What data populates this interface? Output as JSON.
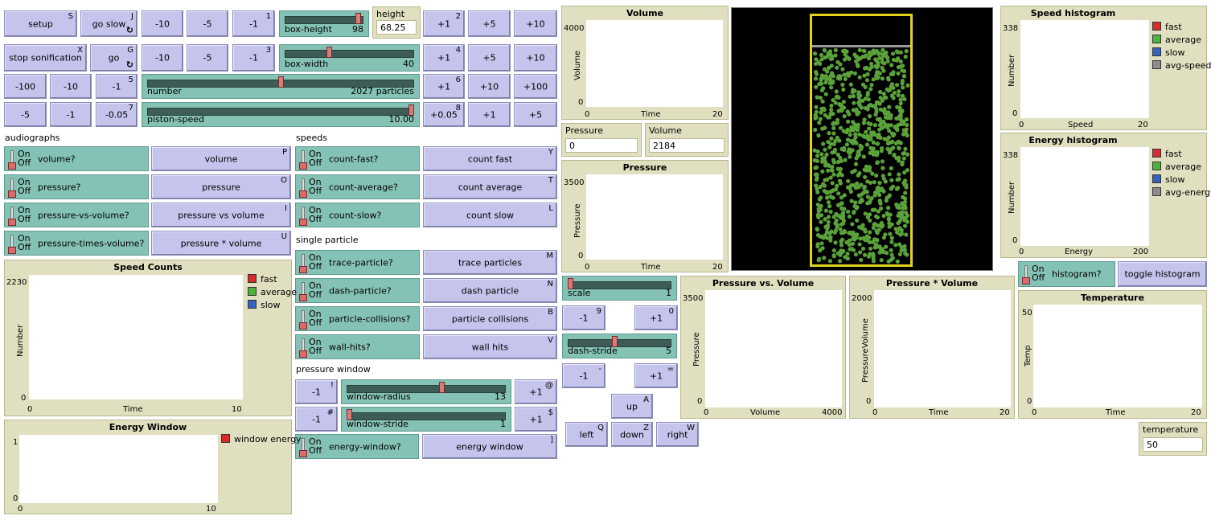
{
  "buttons": {
    "setup": {
      "label": "setup",
      "key": "S"
    },
    "go_slow": {
      "label": "go slow",
      "key": "J"
    },
    "stop_sonification": {
      "label": "stop sonification",
      "key": "X"
    },
    "go": {
      "label": "go",
      "key": "G"
    },
    "row1_dec": [
      "-10",
      "-5",
      "-1"
    ],
    "row1_key": "1",
    "row1_inc": [
      "+1",
      "+5",
      "+10"
    ],
    "row1_inc_key": "2",
    "row2_dec": [
      "-10",
      "-5",
      "-1"
    ],
    "row2_key": "3",
    "row2_inc": [
      "+1",
      "+5",
      "+10"
    ],
    "row2_inc_key": "4",
    "row3_dec": [
      "-100",
      "-10",
      "-1"
    ],
    "row3_key": "5",
    "row3_inc": [
      "+1",
      "+10",
      "+100"
    ],
    "row3_inc_key": "6",
    "row4_dec": [
      "-5",
      "-1",
      "-0.05"
    ],
    "row4_key": "7",
    "row4_inc": [
      "+0.05",
      "+1",
      "+5"
    ],
    "row4_inc_key": "8",
    "audio": [
      {
        "label": "volume",
        "key": "P"
      },
      {
        "label": "pressure",
        "key": "O"
      },
      {
        "label": "pressure vs volume",
        "key": "I"
      },
      {
        "label": "pressure * volume",
        "key": "U"
      }
    ],
    "speeds": [
      {
        "label": "count fast",
        "key": "Y"
      },
      {
        "label": "count average",
        "key": "T"
      },
      {
        "label": "count slow",
        "key": "L"
      }
    ],
    "single": [
      {
        "label": "trace particles",
        "key": "M"
      },
      {
        "label": "dash particle",
        "key": "N"
      },
      {
        "label": "particle collisions",
        "key": "B"
      },
      {
        "label": "wall hits",
        "key": "V"
      }
    ],
    "win_radius_dec": {
      "label": "-1",
      "key": "!"
    },
    "win_radius_inc": {
      "label": "+1",
      "key": "@"
    },
    "win_stride_dec": {
      "label": "-1",
      "key": "#"
    },
    "win_stride_inc": {
      "label": "+1",
      "key": "$"
    },
    "energy_window": {
      "label": "energy window",
      "key": "]"
    },
    "scale_dec": {
      "label": "-1",
      "key": "9"
    },
    "scale_inc": {
      "label": "+1",
      "key": "0"
    },
    "stride_dec": {
      "label": "-1",
      "key": "-"
    },
    "stride_inc": {
      "label": "+1",
      "key": "="
    },
    "up": {
      "label": "up",
      "key": "A"
    },
    "left": {
      "label": "left",
      "key": "Q"
    },
    "down": {
      "label": "down",
      "key": "Z"
    },
    "right": {
      "label": "right",
      "key": "W"
    },
    "toggle_histogram": {
      "label": "toggle histogram"
    }
  },
  "sliders": {
    "box_height": {
      "name": "box-height",
      "value": "98",
      "fraction": 0.97
    },
    "box_width": {
      "name": "box-width",
      "value": "40",
      "fraction": 0.34
    },
    "number": {
      "name": "number",
      "value": "2027 particles",
      "fraction": 0.5
    },
    "piston_speed": {
      "name": "piston-speed",
      "value": "10.00",
      "fraction": 1.0
    },
    "window_radius": {
      "name": "window-radius",
      "value": "13",
      "fraction": 0.6
    },
    "window_stride": {
      "name": "window-stride",
      "value": "1",
      "fraction": 0.0
    },
    "scale": {
      "name": "scale",
      "value": "1",
      "fraction": 0.0
    },
    "dash_stride": {
      "name": "dash-stride",
      "value": "5",
      "fraction": 0.45
    }
  },
  "switch_text": {
    "on": "On",
    "off": "Off"
  },
  "switches": {
    "volume": "volume?",
    "pressure": "pressure?",
    "pressure_vs_volume": "pressure-vs-volume?",
    "pressure_times_volume": "pressure-times-volume?",
    "count_fast": "count-fast?",
    "count_average": "count-average?",
    "count_slow": "count-slow?",
    "trace_particle": "trace-particle?",
    "dash_particle": "dash-particle?",
    "particle_collisions": "particle-collisions?",
    "wall_hits": "wall-hits?",
    "energy_window": "energy-window?",
    "histogram": "histogram?"
  },
  "notes": {
    "audiographs": "audiographs",
    "speeds": "speeds",
    "single_particle": "single particle",
    "pressure_window": "pressure window"
  },
  "monitors": {
    "height": {
      "label": "height",
      "value": "68.25"
    },
    "pressure": {
      "label": "Pressure",
      "value": "0"
    },
    "volume": {
      "label": "Volume",
      "value": "2184"
    },
    "temperature": {
      "label": "temperature",
      "value": "50"
    }
  },
  "plots": {
    "volume": {
      "title": "Volume",
      "ylabel": "Volume",
      "xlabel": "Time",
      "ymax": "4000",
      "ymin": "0",
      "xmin": "0",
      "xmax": "20"
    },
    "pressure": {
      "title": "Pressure",
      "ylabel": "Pressure",
      "xlabel": "Time",
      "ymax": "3500",
      "ymin": "0",
      "xmin": "0",
      "xmax": "20"
    },
    "speed_counts": {
      "title": "Speed Counts",
      "ylabel": "Number",
      "xlabel": "Time",
      "ymax": "2230",
      "ymin": "0",
      "xmin": "0",
      "xmax": "10",
      "legend": [
        {
          "name": "fast",
          "color": "#d92b2b"
        },
        {
          "name": "average",
          "color": "#4bb33b"
        },
        {
          "name": "slow",
          "color": "#3463bf"
        }
      ]
    },
    "energy_window": {
      "title": "Energy Window",
      "ymax": "1",
      "ymin": "0",
      "xmin": "0",
      "xmax": "10",
      "legend": [
        {
          "name": "window energy",
          "color": "#d92b2b"
        }
      ]
    },
    "pv": {
      "title": "Pressure vs. Volume",
      "ylabel": "Pressure",
      "xlabel": "Volume",
      "ymax": "3500",
      "ymin": "0",
      "xmin": "0",
      "xmax": "4000"
    },
    "ptv": {
      "title": "Pressure * Volume",
      "ylabel": "PressureVolume",
      "xlabel": "Time",
      "ymax": "2000",
      "ymin": "0",
      "xmin": "0",
      "xmax": "20"
    },
    "speed_hist": {
      "title": "Speed histogram",
      "ylabel": "Number",
      "xlabel": "Speed",
      "ymax": "338",
      "ymin": "0",
      "xmin": "0",
      "xmax": "20",
      "legend": [
        {
          "name": "fast",
          "color": "#d92b2b"
        },
        {
          "name": "average",
          "color": "#4bb33b"
        },
        {
          "name": "slow",
          "color": "#3463bf"
        },
        {
          "name": "avg-speed",
          "color": "#8c8c8c"
        }
      ]
    },
    "energy_hist": {
      "title": "Energy histogram",
      "ylabel": "Number",
      "xlabel": "Energy",
      "ymax": "338",
      "ymin": "0",
      "xmin": "0",
      "xmax": "200",
      "legend": [
        {
          "name": "fast",
          "color": "#d92b2b"
        },
        {
          "name": "average",
          "color": "#4bb33b"
        },
        {
          "name": "slow",
          "color": "#3463bf"
        },
        {
          "name": "avg-energy",
          "color": "#8c8c8c"
        }
      ]
    },
    "temperature": {
      "title": "Temperature",
      "ylabel": "Temp",
      "xlabel": "Time",
      "ymax": "50",
      "ymin": "0",
      "xmin": "0",
      "xmax": "20"
    }
  },
  "colors": {
    "particle": "#5aa13a",
    "box_wall": "#e3d31f",
    "piston": "#9a9a9a"
  }
}
